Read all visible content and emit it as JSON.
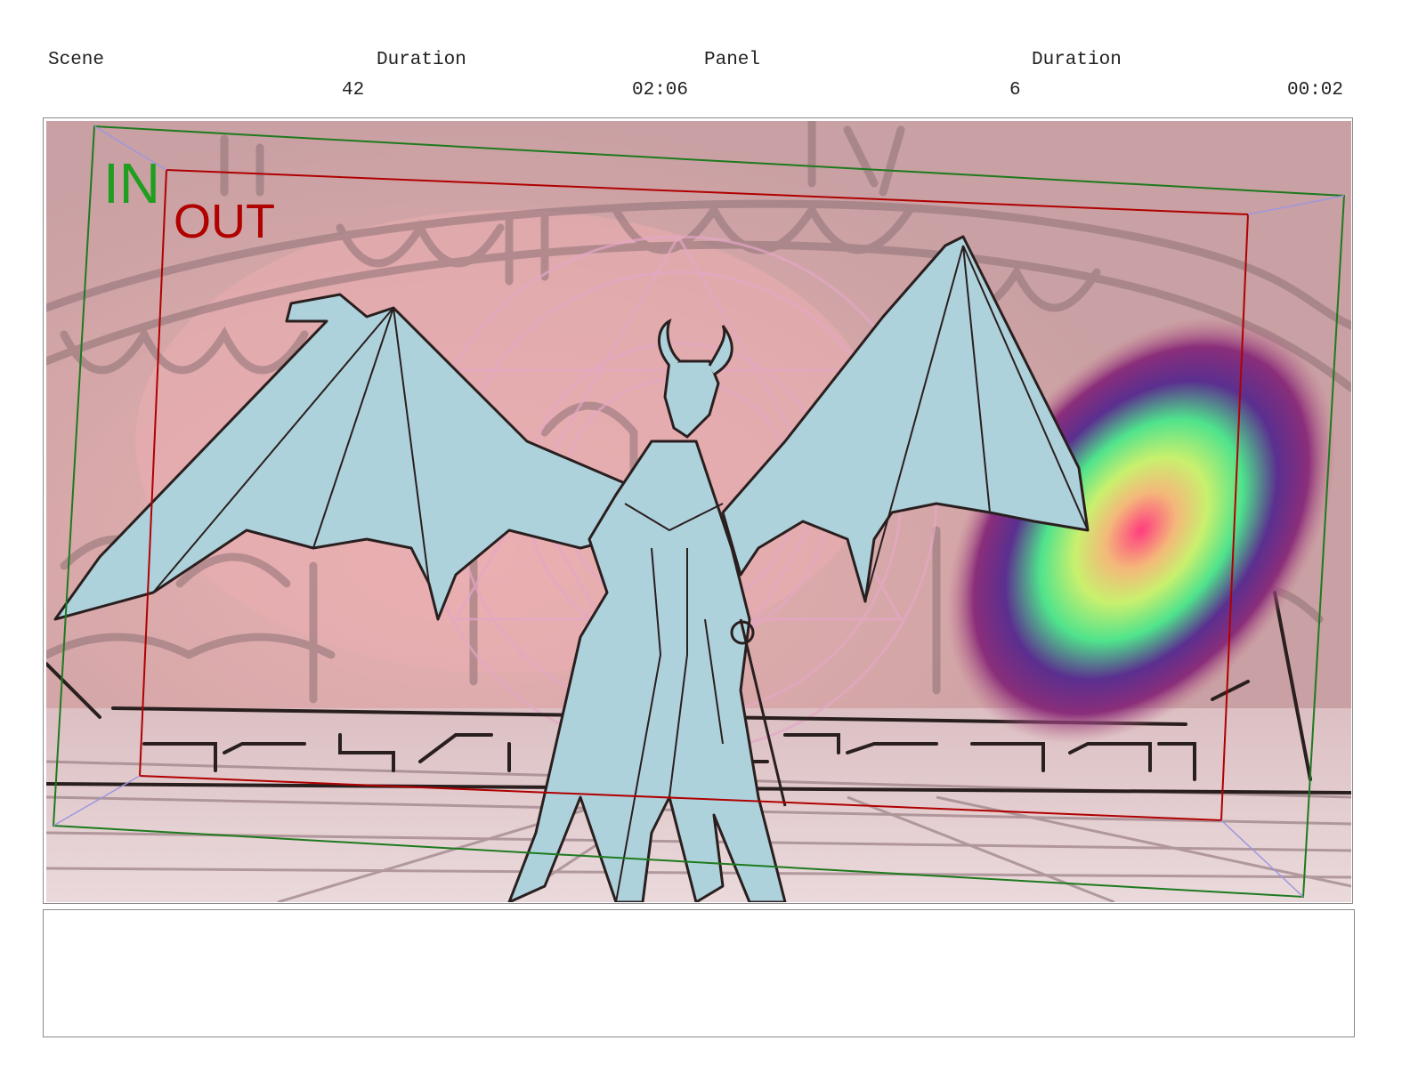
{
  "header": {
    "scene_label": "Scene",
    "scene_value": "42",
    "scene_duration_label": "Duration",
    "scene_duration_value": "02:06",
    "panel_label": "Panel",
    "panel_value": "6",
    "panel_duration_label": "Duration",
    "panel_duration_value": "00:02"
  },
  "frame": {
    "in_label": "IN",
    "out_label": "OUT",
    "in_color": "#1f9e1f",
    "out_color": "#b00000",
    "in_frame_color": "#1e7a1e",
    "out_frame_color": "#b00000",
    "background_color": "#d9a8ab",
    "character_fill": "#aed2dc",
    "line_color": "#2a1f1f"
  },
  "notes": {
    "text": ""
  }
}
